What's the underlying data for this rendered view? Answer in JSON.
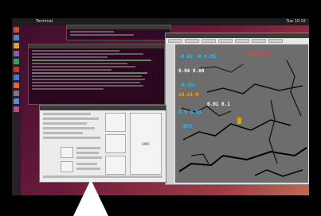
{
  "desktop": {
    "topbar_title": "Terminal",
    "topbar_right": "Tue 10:32"
  },
  "gui_window": {
    "emo_button_label": "EMO"
  },
  "rviz": {
    "map_labels": [
      {
        "text": "-0.01 -0.0.01",
        "color": "#23c4ff"
      },
      {
        "text": "6-1:0.31",
        "color": "#ff3a3a"
      },
      {
        "text": "0.06 0.08",
        "color": "#ffffff"
      },
      {
        "text": "0.53:",
        "color": "#23c4ff"
      },
      {
        "text": "10.61-0",
        "color": "#ffa000"
      },
      {
        "text": "0.01 0.1",
        "color": "#ffffff"
      },
      {
        "text": "0.0 0.03",
        "color": "#23c4ff"
      },
      {
        "text": "NCU",
        "color": "#23c4ff"
      }
    ]
  },
  "colors": {
    "launcher_icons": [
      "#d24b2b",
      "#4a86c5",
      "#e0a030",
      "#8a5ab0",
      "#3aa06a",
      "#c0392b",
      "#3d7bd6",
      "#e06a2a",
      "#7a7a7a",
      "#5a8ad6",
      "#c04a8a"
    ]
  }
}
